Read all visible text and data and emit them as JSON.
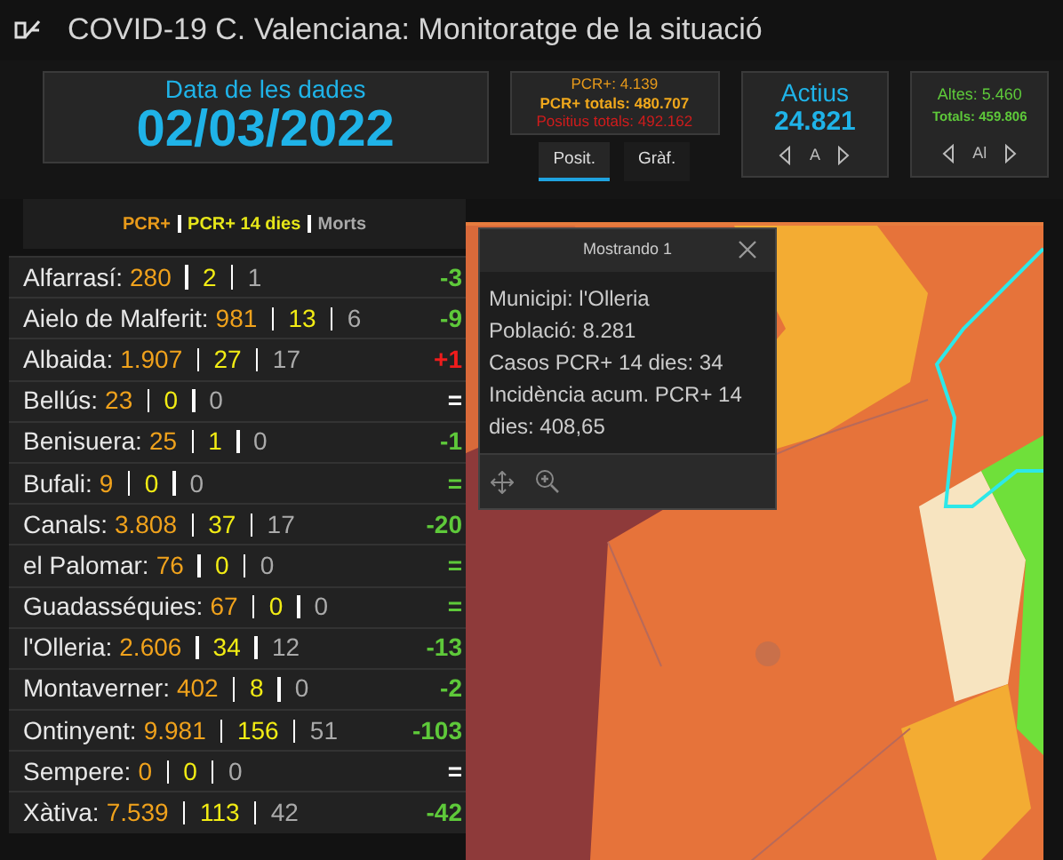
{
  "window": {
    "title": "COVID-19 C. Valenciana: Monitoratge de la situació"
  },
  "date_panel": {
    "label": "Data de les dades",
    "value": "02/03/2022"
  },
  "positives": {
    "lines": [
      {
        "text": "PCR+: 4.139",
        "kind": "pcr"
      },
      {
        "text": "PCR+ totals: 480.707",
        "kind": "pcr-total"
      },
      {
        "text": "Positius totals: 492.162",
        "kind": "positive-total"
      }
    ],
    "tabs": [
      {
        "label": "Posit.",
        "selected": true
      },
      {
        "label": "Gràf.",
        "selected": false
      }
    ]
  },
  "actius": {
    "label": "Actius",
    "value": "24.821",
    "pager_label": "A"
  },
  "altes": {
    "lines": [
      {
        "text": "Altes: 5.460",
        "kind": "main"
      },
      {
        "text": "Totals: 459.806",
        "kind": "sub"
      }
    ],
    "pager_label": "Al"
  },
  "legend": [
    {
      "text": "PCR+",
      "kind": "pcr"
    },
    {
      "text": "PCR+ 14 dies",
      "kind": "pcr14"
    },
    {
      "text": "Morts",
      "kind": "deaths"
    }
  ],
  "rows": [
    {
      "name": "Alfarrasí:",
      "pcr": "280",
      "pcr14": "2",
      "deaths": "1",
      "change": "-3",
      "color": "#5ec93a"
    },
    {
      "name": "Aielo de Malferit:",
      "pcr": "981",
      "pcr14": "13",
      "deaths": "6",
      "change": "-9",
      "color": "#5ec93a"
    },
    {
      "name": "Albaida:",
      "pcr": "1.907",
      "pcr14": "27",
      "deaths": "17",
      "change": "+1",
      "color": "#f01c1c"
    },
    {
      "name": "Bellús:",
      "pcr": "23",
      "pcr14": "0",
      "deaths": "0",
      "change": "=",
      "color": "#ffffff"
    },
    {
      "name": "Benisuera:",
      "pcr": "25",
      "pcr14": "1",
      "deaths": "0",
      "change": "-1",
      "color": "#5ec93a"
    },
    {
      "name": "Bufali:",
      "pcr": "9",
      "pcr14": "0",
      "deaths": "0",
      "change": "=",
      "color": "#5ec93a"
    },
    {
      "name": "Canals:",
      "pcr": "3.808",
      "pcr14": "37",
      "deaths": "17",
      "change": "-20",
      "color": "#5ec93a"
    },
    {
      "name": "el Palomar:",
      "pcr": "76",
      "pcr14": "0",
      "deaths": "0",
      "change": "=",
      "color": "#5ec93a"
    },
    {
      "name": "Guadasséquies:",
      "pcr": "67",
      "pcr14": "0",
      "deaths": "0",
      "change": "=",
      "color": "#5ec93a"
    },
    {
      "name": "l'Olleria:",
      "pcr": "2.606",
      "pcr14": "34",
      "deaths": "12",
      "change": "-13",
      "color": "#5ec93a"
    },
    {
      "name": "Montaverner:",
      "pcr": "402",
      "pcr14": "8",
      "deaths": "0",
      "change": "-2",
      "color": "#5ec93a"
    },
    {
      "name": "Ontinyent:",
      "pcr": "9.981",
      "pcr14": "156",
      "deaths": "51",
      "change": "-103",
      "color": "#5ec93a"
    },
    {
      "name": "Sempere:",
      "pcr": "0",
      "pcr14": "0",
      "deaths": "0",
      "change": "=",
      "color": "#ffffff"
    },
    {
      "name": "Xàtiva:",
      "pcr": "7.539",
      "pcr14": "113",
      "deaths": "42",
      "change": "-42",
      "color": "#5ec93a"
    }
  ],
  "popup": {
    "title": "Mostrando 1",
    "lines": [
      "Municipi: l'Olleria",
      "Població: 8.281",
      "Casos PCR+ 14 dies: 34",
      "Incidència acum. PCR+ 14 dies: 408,65"
    ]
  }
}
